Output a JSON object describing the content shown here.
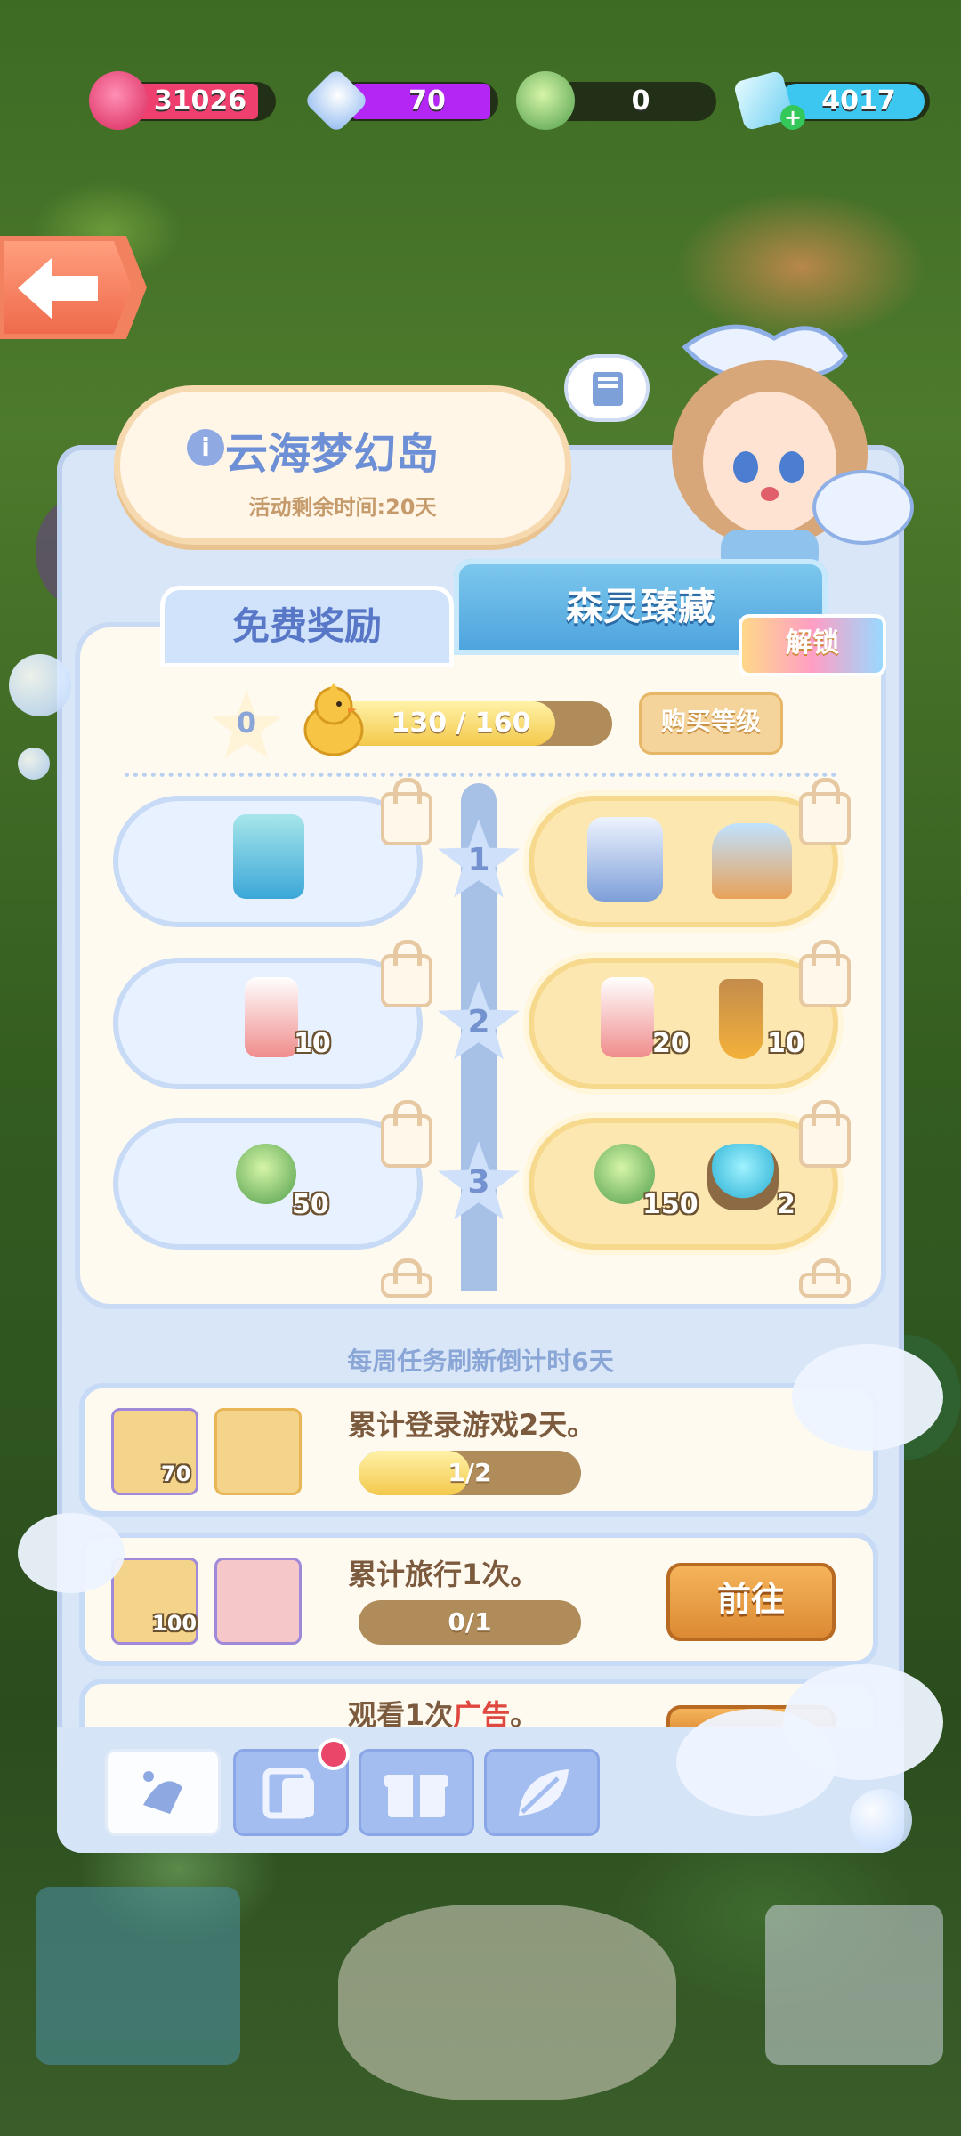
{
  "resources": [
    {
      "name": "red-potion",
      "value": "31026",
      "color": "#ef3f6e"
    },
    {
      "name": "star-gem",
      "value": "70",
      "color": "#b326f4"
    },
    {
      "name": "green-orb",
      "value": "0",
      "color": "#2c3a22"
    },
    {
      "name": "diamond",
      "value": "4017",
      "color": "#3cc7f0"
    }
  ],
  "title": "云海梦幻岛",
  "info_glyph": "i",
  "subtitle": "活动剩余时间:20天",
  "tabs": {
    "free": "免费奖励",
    "premium": "森灵臻藏",
    "unlock": "解锁"
  },
  "level": {
    "value": "0",
    "progress_text": "130 / 160",
    "progress": 0.8125,
    "buy_label": "购买等级"
  },
  "tiers": [
    {
      "num": "1",
      "free_qty": "",
      "prem_qty1": "",
      "prem_qty2": ""
    },
    {
      "num": "2",
      "free_qty": "10",
      "prem_qty1": "20",
      "prem_qty2": "10"
    },
    {
      "num": "3",
      "free_qty": "50",
      "prem_qty1": "150",
      "prem_qty2": "2"
    }
  ],
  "weekly_text": "每周任务刷新倒计时6天",
  "tasks": [
    {
      "title": "累计登录游戏2天。",
      "title_prefix": "",
      "title_hl": "",
      "title_suffix": "",
      "progress": "1/2",
      "ratio": 0.5,
      "qty1": "70",
      "qty2": "",
      "button": ""
    },
    {
      "title": "累计旅行1次。",
      "title_prefix": "",
      "title_hl": "",
      "title_suffix": "",
      "progress": "0/1",
      "ratio": 0,
      "qty1": "100",
      "qty2": "",
      "button": "前往"
    },
    {
      "title": "",
      "title_prefix": "观看1次",
      "title_hl": "广告",
      "title_suffix": "。",
      "progress": "",
      "ratio": 0,
      "qty1": "",
      "qty2": "",
      "button": ""
    }
  ],
  "nav": [
    {
      "icon": "candy-icon",
      "active": true
    },
    {
      "icon": "ticket-icon",
      "active": false,
      "badge": true
    },
    {
      "icon": "gift-icon",
      "active": false
    },
    {
      "icon": "leaf-icon",
      "active": false
    }
  ]
}
